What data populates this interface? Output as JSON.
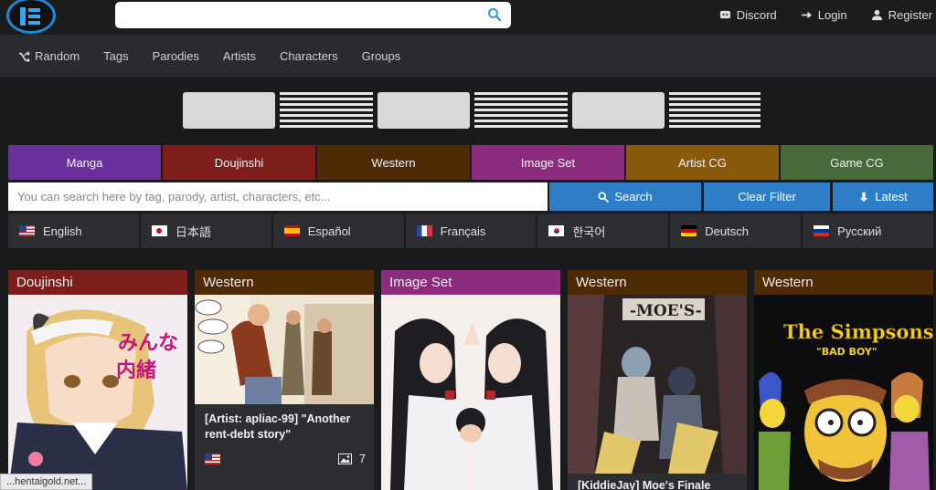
{
  "header": {
    "links": [
      {
        "label": "Discord",
        "icon": "discord-icon"
      },
      {
        "label": "Login",
        "icon": "login-icon"
      },
      {
        "label": "Register",
        "icon": "user-icon"
      }
    ]
  },
  "nav": {
    "items": [
      {
        "label": "Random",
        "icon": "shuffle-icon"
      },
      {
        "label": "Tags"
      },
      {
        "label": "Parodies"
      },
      {
        "label": "Artists"
      },
      {
        "label": "Characters"
      },
      {
        "label": "Groups"
      }
    ]
  },
  "categories": [
    {
      "label": "Manga",
      "color": "#6a2f9b"
    },
    {
      "label": "Doujinshi",
      "color": "#7e1e1c"
    },
    {
      "label": "Western",
      "color": "#4f2a07"
    },
    {
      "label": "Image Set",
      "color": "#8c2c7c"
    },
    {
      "label": "Artist CG",
      "color": "#8a5a0c"
    },
    {
      "label": "Game CG",
      "color": "#47693c"
    }
  ],
  "search": {
    "placeholder": "You can search here by tag, parody, artist, characters, etc...",
    "search_label": "Search",
    "clear_label": "Clear Filter",
    "latest_label": "Latest"
  },
  "languages": [
    {
      "label": "English",
      "flag": "us"
    },
    {
      "label": "日本語",
      "flag": "jp"
    },
    {
      "label": "Español",
      "flag": "es"
    },
    {
      "label": "Français",
      "flag": "fr"
    },
    {
      "label": "한국어",
      "flag": "kr"
    },
    {
      "label": "Deutsch",
      "flag": "de"
    },
    {
      "label": "Русский",
      "flag": "ru"
    }
  ],
  "cards": [
    {
      "category": "Doujinshi",
      "badge_color": "#7e1e1c",
      "title": "",
      "count": ""
    },
    {
      "category": "Western",
      "badge_color": "#4f2a07",
      "title": "[Artist: apliac-99] \"Another rent-debt story\"",
      "count": "7"
    },
    {
      "category": "Image Set",
      "badge_color": "#8c2c7c",
      "title": "",
      "count": ""
    },
    {
      "category": "Western",
      "badge_color": "#4f2a07",
      "title": "[KiddieJay] Moe's Finale",
      "count": ""
    },
    {
      "category": "Western",
      "badge_color": "#4f2a07",
      "title": "",
      "count": ""
    }
  ],
  "status_bar": {
    "url": "...hentaigold.net..."
  },
  "colors": {
    "accent_blue": "#2d7ec6",
    "background": "#1a1b1d"
  }
}
